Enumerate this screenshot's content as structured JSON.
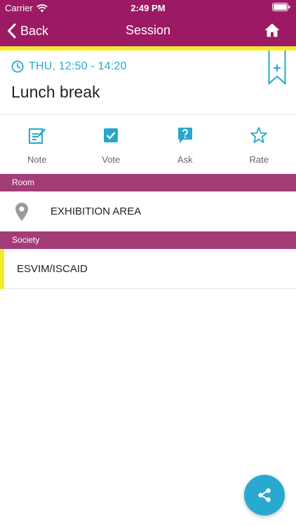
{
  "statusbar": {
    "carrier": "Carrier",
    "time": "2:49 PM"
  },
  "navbar": {
    "back_label": "Back",
    "title": "Session",
    "home_icon": "home-icon"
  },
  "session": {
    "time_icon": "clock-icon",
    "time": "THU, 12:50 - 14:20",
    "title": "Lunch break",
    "bookmark_icon": "bookmark-add-icon"
  },
  "actions": [
    {
      "label": "Note",
      "icon": "note-edit-icon"
    },
    {
      "label": "Vote",
      "icon": "checkbox-icon"
    },
    {
      "label": "Ask",
      "icon": "question-bubble-icon"
    },
    {
      "label": "Rate",
      "icon": "star-icon"
    }
  ],
  "room": {
    "header": "Room",
    "value": "EXHIBITION AREA",
    "icon": "map-pin-icon"
  },
  "society": {
    "header": "Society",
    "value": "ESVIM/ISCAID"
  },
  "fab": {
    "icon": "share-icon"
  },
  "colors": {
    "header_bg": "#9c1a63",
    "section_bg": "#a43c78",
    "accent_yellow": "#f2ec2b",
    "accent_blue": "#27a8c9"
  }
}
